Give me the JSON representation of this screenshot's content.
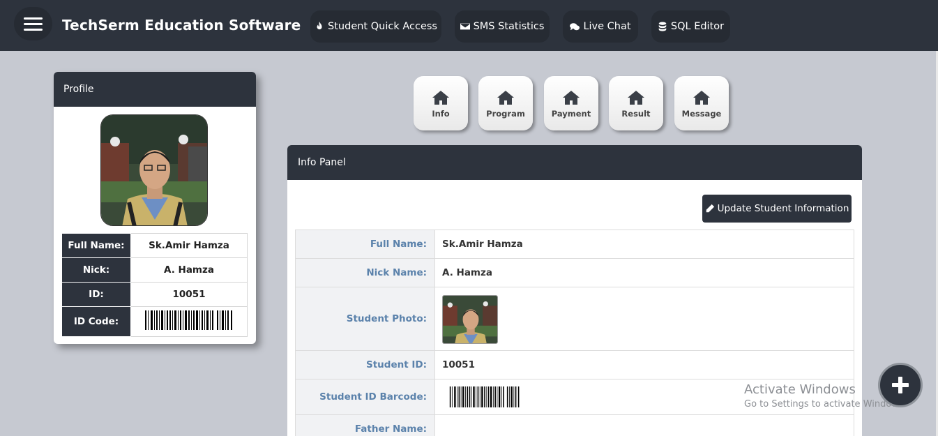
{
  "app": {
    "title": "TechSerm Education Software"
  },
  "nav": [
    {
      "label": "Student Quick Access",
      "icon": "fire-icon"
    },
    {
      "label": "SMS Statistics",
      "icon": "envelope-icon"
    },
    {
      "label": "Live Chat",
      "icon": "chat-icon"
    },
    {
      "label": "SQL Editor",
      "icon": "database-icon"
    }
  ],
  "profile": {
    "heading": "Profile",
    "rows": [
      {
        "label": "Full Name:",
        "value": "Sk.Amir Hamza"
      },
      {
        "label": "Nick:",
        "value": "A. Hamza"
      },
      {
        "label": "ID:",
        "value": "10051"
      },
      {
        "label": "ID Code:",
        "value": ""
      }
    ]
  },
  "tabs": [
    {
      "label": "Info",
      "icon": "home-icon"
    },
    {
      "label": "Program",
      "icon": "home-icon"
    },
    {
      "label": "Payment",
      "icon": "home-icon"
    },
    {
      "label": "Result",
      "icon": "home-icon"
    },
    {
      "label": "Message",
      "icon": "home-icon"
    }
  ],
  "info_panel": {
    "heading": "Info Panel",
    "update_label": "Update Student Information",
    "rows": [
      {
        "label": "Full Name:",
        "value": "Sk.Amir Hamza"
      },
      {
        "label": "Nick Name:",
        "value": "A. Hamza"
      },
      {
        "label": "Student Photo:",
        "value": ""
      },
      {
        "label": "Student ID:",
        "value": "10051"
      },
      {
        "label": "Student ID Barcode:",
        "value": ""
      },
      {
        "label": "Father Name:",
        "value": ""
      }
    ]
  },
  "watermark": {
    "title": "Activate Windows",
    "subtitle": "Go to Settings to activate Windows."
  },
  "colors": {
    "topbar": "#2d333d",
    "background": "#c6c9d1",
    "label_text": "#5b82ab"
  }
}
